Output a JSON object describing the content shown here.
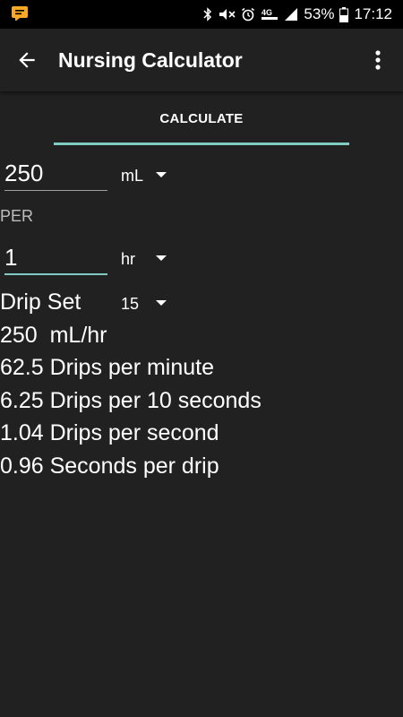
{
  "status_bar": {
    "notification_icon": "message-notification-icon",
    "icons": [
      "bluetooth-icon",
      "mute-icon",
      "alarm-icon",
      "4g-lte-icon",
      "signal-icon"
    ],
    "battery_percent": "53%",
    "battery_icon": "battery-icon",
    "time": "17:12"
  },
  "app_bar": {
    "back_icon": "arrow-back-icon",
    "title": "Nursing Calculator",
    "menu_icon": "more-vert-icon"
  },
  "tabs": [
    {
      "label": "CALCULATE",
      "selected": true
    }
  ],
  "form": {
    "volume_value": "250",
    "volume_unit": "mL",
    "per_label": "PER",
    "time_value": "1",
    "time_unit": "hr",
    "drip_set_label": "Drip Set",
    "drip_set_value": "15"
  },
  "results": [
    "250  mL/hr",
    "62.5 Drips per minute",
    "6.25 Drips per 10 seconds",
    "1.04 Drips per second",
    "0.96 Seconds per drip"
  ],
  "colors": {
    "background": "#212121",
    "accent": "#80cbc4",
    "status_bar": "#000000",
    "notification_icon": "#f9a825"
  }
}
